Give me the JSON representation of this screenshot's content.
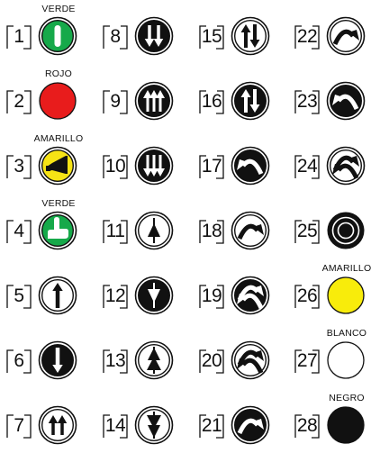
{
  "buttons": [
    {
      "number": "1",
      "caption": "VERDE",
      "symbol": "vertical-bar-icon",
      "fill": "#16a94a"
    },
    {
      "number": "2",
      "caption": "ROJO",
      "symbol": "plain-red-circle",
      "fill": "#e81c1c"
    },
    {
      "number": "3",
      "caption": "AMARILLO",
      "symbol": "horn-icon",
      "fill": "#f6e315"
    },
    {
      "number": "4",
      "caption": "VERDE",
      "symbol": "hand-icon",
      "fill": "#16a94a"
    },
    {
      "number": "5",
      "caption": "",
      "symbol": "arrow-up-icon",
      "fill": "#ffffff"
    },
    {
      "number": "6",
      "caption": "",
      "symbol": "arrow-down-icon",
      "fill": "#111111"
    },
    {
      "number": "7",
      "caption": "",
      "symbol": "double-arrow-up-icon",
      "fill": "#ffffff"
    },
    {
      "number": "8",
      "caption": "",
      "symbol": "double-arrow-down-icon",
      "fill": "#111111"
    },
    {
      "number": "9",
      "caption": "",
      "symbol": "triple-arrow-up-icon",
      "fill": "#111111"
    },
    {
      "number": "10",
      "caption": "",
      "symbol": "triple-arrow-down-icon",
      "fill": "#111111"
    },
    {
      "number": "11",
      "caption": "",
      "symbol": "triangle-up-icon",
      "fill": "#ffffff"
    },
    {
      "number": "12",
      "caption": "",
      "symbol": "triangle-down-icon",
      "fill": "#111111"
    },
    {
      "number": "13",
      "caption": "",
      "symbol": "double-triangle-up-icon",
      "fill": "#ffffff"
    },
    {
      "number": "14",
      "caption": "",
      "symbol": "double-triangle-down-icon",
      "fill": "#ffffff"
    },
    {
      "number": "15",
      "caption": "",
      "symbol": "up-down-arrows-icon",
      "fill": "#ffffff"
    },
    {
      "number": "16",
      "caption": "",
      "symbol": "up-down-arrows-icon",
      "fill": "#111111"
    },
    {
      "number": "17",
      "caption": "",
      "symbol": "arc-arrow-left-icon",
      "fill": "#111111"
    },
    {
      "number": "18",
      "caption": "",
      "symbol": "arc-arrow-right-icon",
      "fill": "#ffffff"
    },
    {
      "number": "19",
      "caption": "",
      "symbol": "double-arc-arrow-icon",
      "fill": "#111111"
    },
    {
      "number": "20",
      "caption": "",
      "symbol": "double-arc-arrow-icon",
      "fill": "#ffffff"
    },
    {
      "number": "21",
      "caption": "",
      "symbol": "arc-arrow-right-icon",
      "fill": "#111111"
    },
    {
      "number": "22",
      "caption": "",
      "symbol": "arc-arrow-right-icon",
      "fill": "#ffffff"
    },
    {
      "number": "23",
      "caption": "",
      "symbol": "arc-arrow-left-icon",
      "fill": "#111111"
    },
    {
      "number": "24",
      "caption": "",
      "symbol": "double-arc-arrow-icon",
      "fill": "#ffffff"
    },
    {
      "number": "25",
      "caption": "",
      "symbol": "concentric-circles-icon",
      "fill": "#111111"
    },
    {
      "number": "26",
      "caption": "AMARILLO",
      "symbol": "plain-yellow-circle",
      "fill": "#f8ec0b"
    },
    {
      "number": "27",
      "caption": "BLANCO",
      "symbol": "plain-white-circle",
      "fill": "#ffffff"
    },
    {
      "number": "28",
      "caption": "NEGRO",
      "symbol": "plain-black-circle",
      "fill": "#111111"
    }
  ]
}
